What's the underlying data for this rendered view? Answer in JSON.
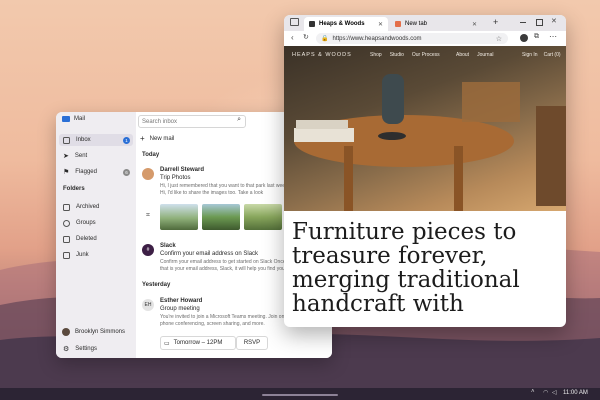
{
  "mail": {
    "app_name": "Mail",
    "search_placeholder": "Search inbox",
    "new_mail": "New mail",
    "folders_nav": [
      {
        "label": "Inbox",
        "count": "1"
      },
      {
        "label": "Sent"
      },
      {
        "label": "Flagged",
        "count": "6"
      }
    ],
    "folders_heading": "Folders",
    "folders": [
      {
        "label": "Archived"
      },
      {
        "label": "Groups"
      },
      {
        "label": "Deleted"
      },
      {
        "label": "Junk"
      }
    ],
    "account_name": "Brooklyn Simmons",
    "settings_label": "Settings",
    "today_label": "Today",
    "yesterday_label": "Yesterday",
    "messages": [
      {
        "sender": "Darrell Steward",
        "subject": "Trip Photos",
        "preview_1": "Hi, I just remembered that you want to that park last week",
        "preview_2": "Hi, I'd like to share the images too. Take a look"
      },
      {
        "sender": "Slack",
        "subject": "Confirm your email address on Slack",
        "preview_1": "Confirm your email address to get started on Slack Once",
        "preview_2": "that is your email address, Slack, it will help you find your Slack"
      },
      {
        "sender": "Esther Howard",
        "initials": "EH",
        "subject": "Group meeting",
        "preview_1": "You're invited to join a Microsoft Teams meeting. Join on",
        "preview_2": "phone conferencing, screen sharing, and more."
      }
    ],
    "meeting_time": "Tomorrow – 12PM",
    "rsvp": "RSVP"
  },
  "browser": {
    "tabs": [
      {
        "label": "Heaps & Woods"
      },
      {
        "label": "New tab"
      }
    ],
    "new_tab_symbol": "+",
    "url": "https://www.heapsandwoods.com",
    "site": {
      "logo": "HEAPS & WOODS",
      "nav": [
        "Shop",
        "Studio",
        "Our Process"
      ],
      "nav_right": [
        "About",
        "Journal"
      ],
      "signin": "Sign In",
      "cart": "Cart (0)",
      "headline": "Furniture pieces to treasure forever, merging traditional handcraft with"
    }
  },
  "taskbar": {
    "time": "11:00 AM"
  },
  "colors": {
    "accent": "#2a6fd6",
    "badge_gray": "#8a8a8a"
  }
}
